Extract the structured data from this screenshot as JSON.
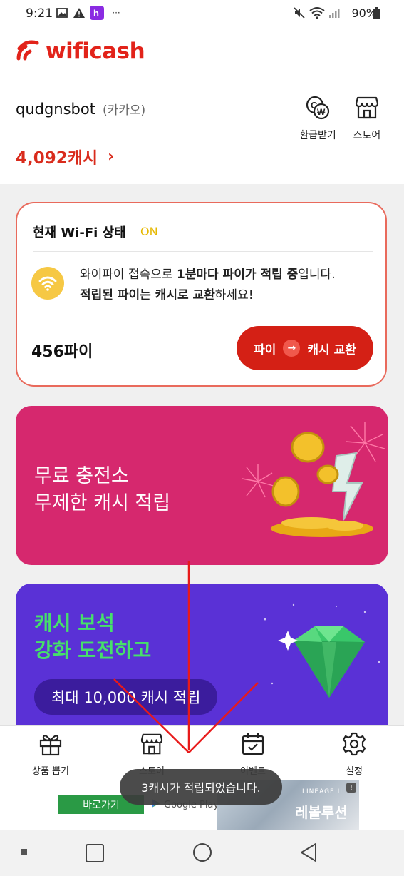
{
  "status_bar": {
    "time": "9:21",
    "battery": "90%"
  },
  "app": {
    "name": "wificash"
  },
  "account": {
    "username": "qudgnsbot",
    "provider": "(카카오)",
    "cash": "4,092캐시"
  },
  "header_buttons": {
    "refund": "환급받기",
    "store": "스토어"
  },
  "wifi_card": {
    "title": "현재 Wi-Fi 상태",
    "status": "ON",
    "message_line1_prefix": "와이파이 접속으로 ",
    "message_line1_bold": "1분마다 파이가 적립 중",
    "message_line1_suffix": "입니다.",
    "message_line2_bold": "적립된 파이는 캐시로 교환",
    "message_line2_suffix": "하세요!",
    "pie_amount": "456파이",
    "exchange_from": "파이",
    "exchange_to": "캐시 교환"
  },
  "banner_free": {
    "line1": "무료 충전소",
    "line2": "무제한 캐시 적립"
  },
  "banner_gem": {
    "line1": "캐시 보석",
    "line2": "강화 도전하고",
    "pill": "최대 10,000 캐시 적립"
  },
  "bottom_nav": {
    "gift": "상품 뽑기",
    "store": "스토어",
    "event": "이벤트",
    "settings": "설정"
  },
  "ad": {
    "button": "바로가기",
    "store_badge": "Google Play",
    "game_title": "레볼루션",
    "brand": "LINEAGE II"
  },
  "toast": "3캐시가 적립되었습니다.",
  "colors": {
    "brand_red": "#e2231a",
    "cash_red": "#d92b1c",
    "pink_banner": "#d6286e",
    "purple_banner": "#5a31d6",
    "gem_text": "#46e06a"
  }
}
